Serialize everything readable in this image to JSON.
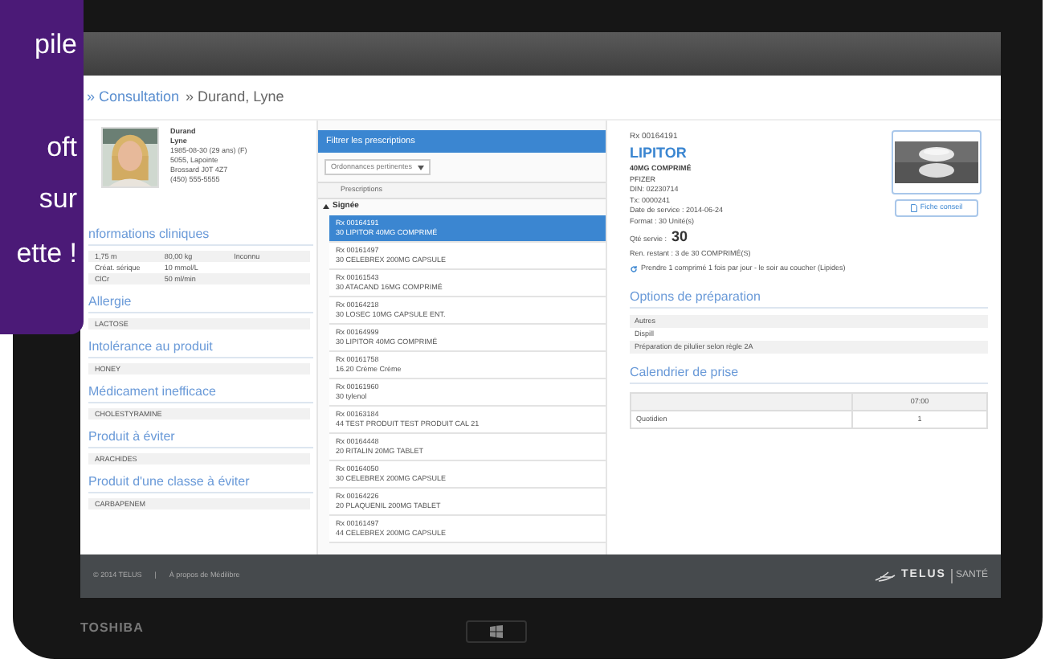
{
  "banner": {
    "lines": [
      "pile",
      "oft",
      "sur",
      "ette !"
    ]
  },
  "breadcrumb": [
    "» Consultation",
    "» Durand, Lyne"
  ],
  "patient": {
    "last_name": "Durand",
    "first_name": "Lyne",
    "birth": "1985-08-30 (29 ans) (F)",
    "address": "5055, Lapointe",
    "city": "Brossard J0T 4Z7",
    "phone": "(450) 555-5555"
  },
  "left_sections": [
    {
      "title": "nformations cliniques",
      "rows": [
        [
          "1,75 m",
          "80,00 kg",
          "Inconnu"
        ],
        [
          "Créat. sérique",
          "10 mmol/L"
        ],
        [
          "ClCr",
          "50 ml/min"
        ]
      ]
    },
    {
      "title": "Allergie",
      "rows": [
        [
          "LACTOSE"
        ]
      ]
    },
    {
      "title": "Intolérance au produit",
      "rows": [
        [
          "HONEY"
        ]
      ]
    },
    {
      "title": "Médicament inefficace",
      "rows": [
        [
          "CHOLESTYRAMINE"
        ]
      ]
    },
    {
      "title": "Produit à éviter",
      "rows": [
        [
          "ARACHIDES"
        ]
      ]
    },
    {
      "title": "Produit d'une classe à éviter",
      "rows": [
        [
          "CARBAPENEM"
        ]
      ]
    }
  ],
  "prescriptions": {
    "filter_title": "Filtrer les prescriptions",
    "filter_select": "Ordonnances pertinentes",
    "column": "Prescriptions",
    "groups": [
      {
        "label": "Signée",
        "expanded": true,
        "items": [
          {
            "rx": "Rx 00164191",
            "drug": "30 LIPITOR 40MG COMPRIMÉ",
            "selected": true
          },
          {
            "rx": "Rx 00161497",
            "drug": "30 CELEBREX 200MG CAPSULE",
            "selected": false
          },
          {
            "rx": "Rx 00161543",
            "drug": "30 ATACAND 16MG COMPRIMÉ",
            "selected": false
          },
          {
            "rx": "Rx 00164218",
            "drug": "30 LOSEC 10MG CAPSULE ENT.",
            "selected": false
          },
          {
            "rx": "Rx 00164999",
            "drug": "30 LIPITOR 40MG COMPRIMÉ",
            "selected": false
          },
          {
            "rx": "Rx 00161758",
            "drug": "16.20 Crème Crème",
            "selected": false
          },
          {
            "rx": "Rx 00161960",
            "drug": "30 tylenol",
            "selected": false
          },
          {
            "rx": "Rx 00163184",
            "drug": "44 TEST PRODUIT TEST PRODUIT CAL 21",
            "selected": false
          },
          {
            "rx": "Rx 00164448",
            "drug": "20 RITALIN 20MG TABLET",
            "selected": false
          },
          {
            "rx": "Rx 00164050",
            "drug": "30 CELEBREX 200MG CAPSULE",
            "selected": false
          },
          {
            "rx": "Rx 00164226",
            "drug": "20 PLAQUENIL 200MG TABLET",
            "selected": false
          },
          {
            "rx": "Rx 00161497",
            "drug": "44 CELEBREX 200MG CAPSULE",
            "selected": false
          }
        ]
      }
    ]
  },
  "detail": {
    "rx": "Rx 00164191",
    "name": "LIPITOR",
    "form": "40MG COMPRIMÉ",
    "maker": "PFIZER",
    "info": [
      "DIN: 02230714",
      "Tx: 0000241",
      "Date de service : 2014-06-24",
      "Format : 30 Unité(s)"
    ],
    "quantity_label": "Qté servie :",
    "quantity": "30",
    "remaining": "Ren. restant : 3 de 30 COMPRIMÉ(S)",
    "instructions": "Prendre 1 comprimé 1 fois par jour - le soir au coucher (Lipides)",
    "button": "Fiche conseil",
    "preparation": {
      "title": "Options de préparation",
      "rows": [
        "Autres",
        "Dispill",
        "Préparation de pilulier selon règle 2A"
      ]
    },
    "schedule": {
      "title": "Calendrier de prise",
      "time": "07:00",
      "rows": [
        {
          "label": "Quotidien",
          "value": "1"
        }
      ]
    }
  },
  "footer": {
    "copyright": "© 2014 TELUS",
    "separator": "|",
    "link": "À propos de Médilibre",
    "brand": "TELUS",
    "brand_sub": "SANTÉ"
  },
  "device": {
    "brand": "TOSHIBA"
  }
}
